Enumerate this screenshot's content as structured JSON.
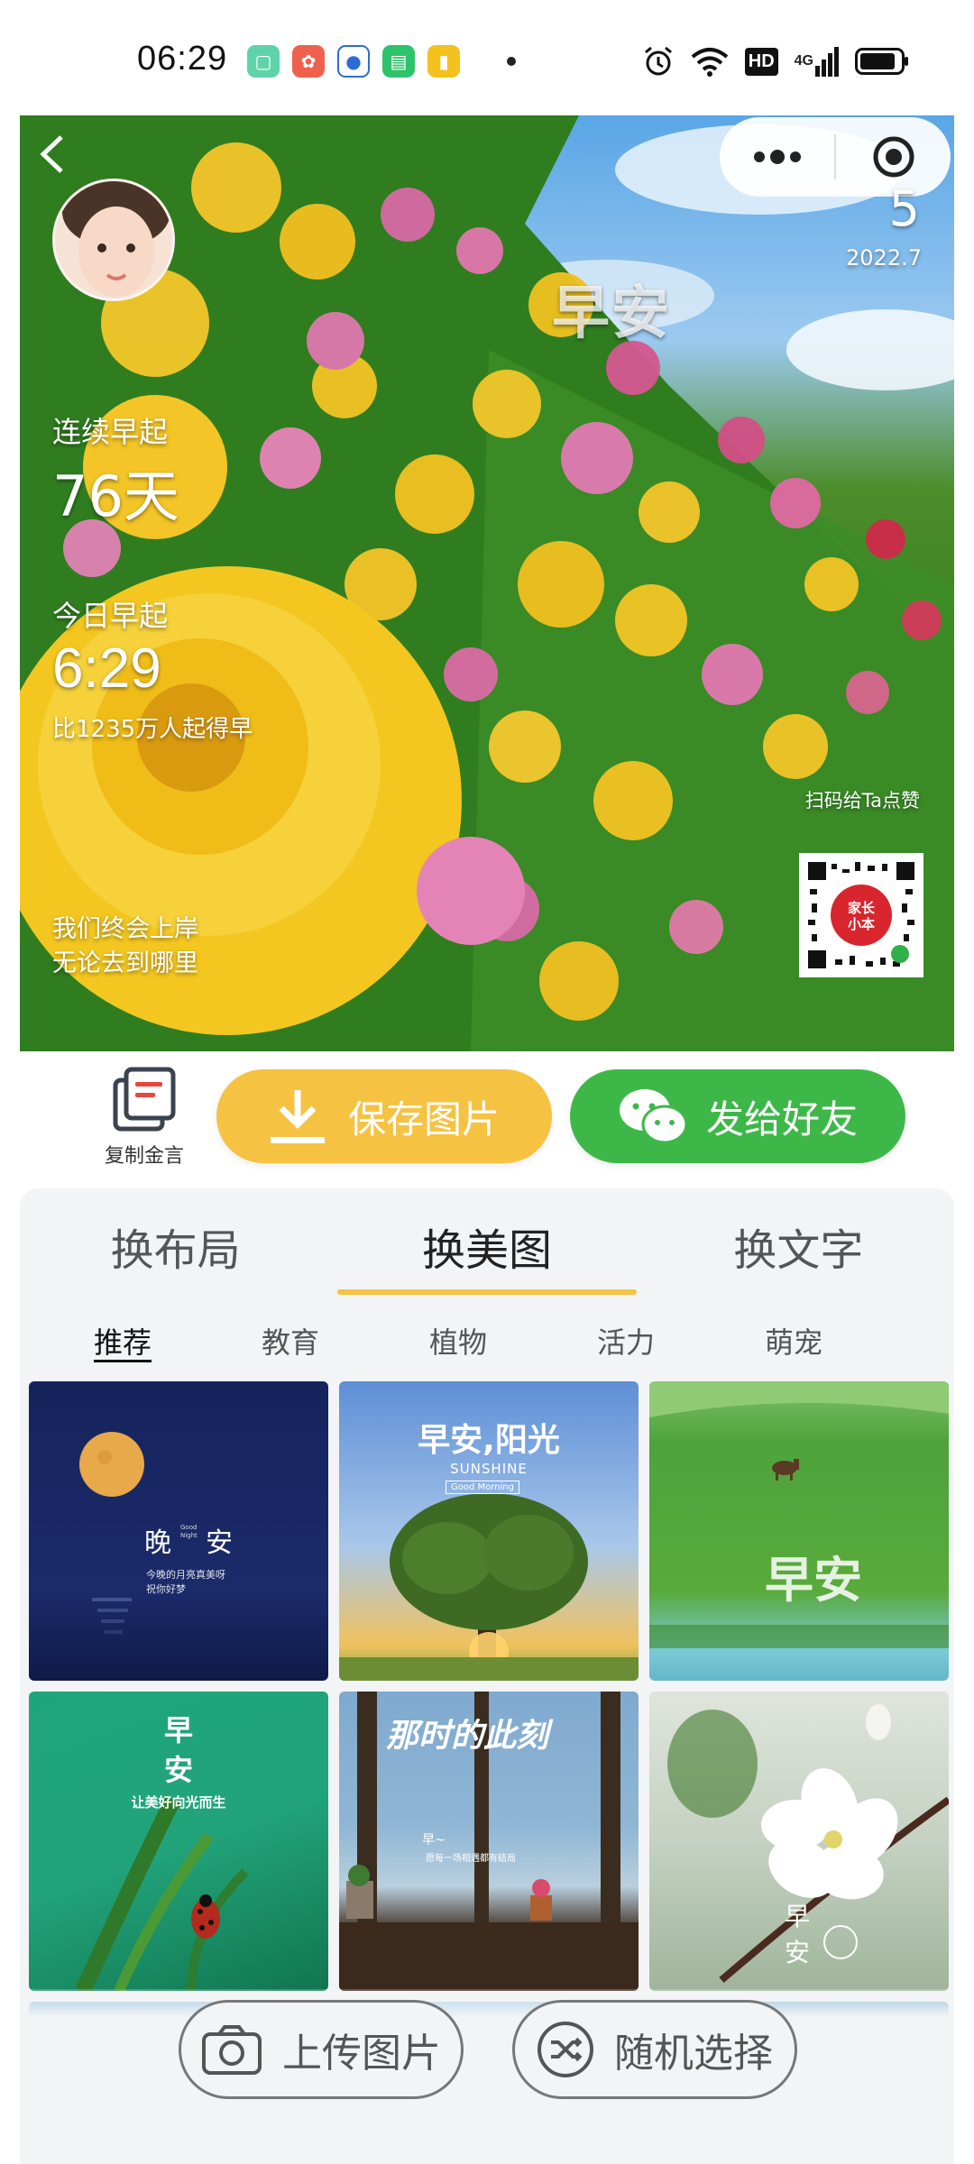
{
  "status_bar": {
    "time": "06:29",
    "network_badge": "HD",
    "network_gen": "4G"
  },
  "hero": {
    "date_day": "5",
    "date_month": "2022.7",
    "watermark": "早安",
    "streak_label": "连续早起",
    "streak_value": "76天",
    "today_label": "今日早起",
    "today_time": "6:29",
    "rank_text": "比1235万人起得早",
    "quote_line1": "我们终会上岸",
    "quote_line2": "无论去到哪里",
    "qr_label": "扫码给Ta点赞",
    "qr_badge": "家长\n小本"
  },
  "actions": {
    "copy_label": "复制金言",
    "save_label": "保存图片",
    "send_label": "发给好友"
  },
  "tabs": [
    {
      "label": "换布局",
      "active": false
    },
    {
      "label": "换美图",
      "active": true
    },
    {
      "label": "换文字",
      "active": false
    }
  ],
  "subtabs": [
    {
      "label": "推荐",
      "active": true
    },
    {
      "label": "教育",
      "active": false
    },
    {
      "label": "植物",
      "active": false
    },
    {
      "label": "活力",
      "active": false
    },
    {
      "label": "萌宠",
      "active": false
    }
  ],
  "thumbs": {
    "t1": {
      "big_a": "晚",
      "small": "Good\nNight",
      "big_b": "安",
      "line1": "今晚的月亮真美呀",
      "line2": "祝你好梦"
    },
    "t2": {
      "title": "早安,阳光",
      "sub": "SUNSHINE",
      "tag": "Good Morning"
    },
    "t3": {
      "title": "早安"
    },
    "t4": {
      "a": "早",
      "b": "安",
      "line": "让美好向光而生"
    },
    "t5": {
      "title": "那时的此刻",
      "a": "早~",
      "line": "愿每一场相遇都有结局"
    },
    "t6": {
      "a": "早",
      "b": "安"
    }
  },
  "bottom_actions": {
    "upload_label": "上传图片",
    "random_label": "随机选择"
  },
  "colors": {
    "accent_yellow": "#f6c242",
    "wechat_green": "#3db848",
    "panel_bg": "#f3f4f6"
  },
  "icons": [
    "back-icon",
    "more-icon",
    "target-icon",
    "copy-icon",
    "download-icon",
    "wechat-icon",
    "camera-icon",
    "shuffle-icon"
  ]
}
